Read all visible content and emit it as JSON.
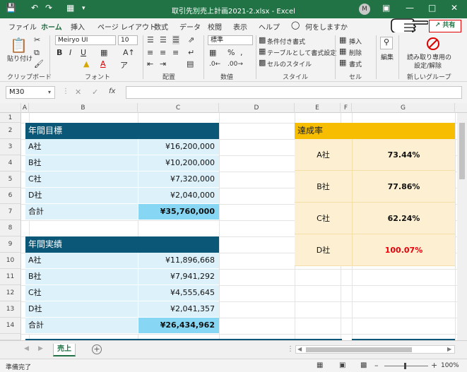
{
  "titlebar": {
    "title": "取引先別売上計画2021-2.xlsx  -  Excel",
    "avatar_initial": "M"
  },
  "menu": {
    "tabs": [
      "ファイル",
      "ホーム",
      "挿入",
      "ページ レイアウト",
      "数式",
      "データ",
      "校閲",
      "表示",
      "ヘルプ",
      "何をしますか"
    ],
    "active": "ホーム",
    "share_label": "共有"
  },
  "ribbon": {
    "clipboard": {
      "paste": "貼り付け",
      "label": "クリップボード"
    },
    "font": {
      "name": "Meiryo UI",
      "size": "10",
      "label": "フォント"
    },
    "alignment": {
      "label": "配置"
    },
    "number": {
      "format": "標準",
      "label": "数値"
    },
    "styles": {
      "conditional": "条件付き書式",
      "table": "テーブルとして書式設定",
      "cell_style": "セルのスタイル",
      "label": "スタイル"
    },
    "cells": {
      "insert": "挿入",
      "delete": "削除",
      "format": "書式",
      "label": "セル"
    },
    "editing": {
      "label": "編集"
    },
    "readonly": {
      "line1": "読み取り専用の",
      "line2": "設定/解除",
      "label": "新しいグループ"
    }
  },
  "formulabar": {
    "namebox": "M30",
    "fx": "fx"
  },
  "columns": [
    "A",
    "B",
    "C",
    "D",
    "E",
    "F",
    "G"
  ],
  "rows": [
    "1",
    "2",
    "3",
    "4",
    "5",
    "6",
    "7",
    "8",
    "9",
    "10",
    "11",
    "12",
    "13",
    "14"
  ],
  "targets": {
    "title": "年間目標",
    "rows": [
      {
        "name": "A社",
        "value": "¥16,200,000"
      },
      {
        "name": "B社",
        "value": "¥10,200,000"
      },
      {
        "name": "C社",
        "value": "¥7,320,000"
      },
      {
        "name": "D社",
        "value": "¥2,040,000"
      }
    ],
    "total_label": "合計",
    "total_value": "¥35,760,000"
  },
  "actuals": {
    "title": "年間実績",
    "rows": [
      {
        "name": "A社",
        "value": "¥11,896,668"
      },
      {
        "name": "B社",
        "value": "¥7,941,292"
      },
      {
        "name": "C社",
        "value": "¥4,555,645"
      },
      {
        "name": "D社",
        "value": "¥2,041,357"
      }
    ],
    "total_label": "合計",
    "total_value": "¥26,434,962"
  },
  "achievement": {
    "title": "達成率",
    "rows": [
      {
        "name": "A社",
        "value": "73.44%"
      },
      {
        "name": "B社",
        "value": "77.86%"
      },
      {
        "name": "C社",
        "value": "62.24%"
      },
      {
        "name": "D社",
        "value": "100.07%"
      }
    ],
    "highlight_color": "#e8000b"
  },
  "sheets": {
    "active": "売上"
  },
  "status": {
    "left": "準備完了",
    "zoom": "100%"
  }
}
